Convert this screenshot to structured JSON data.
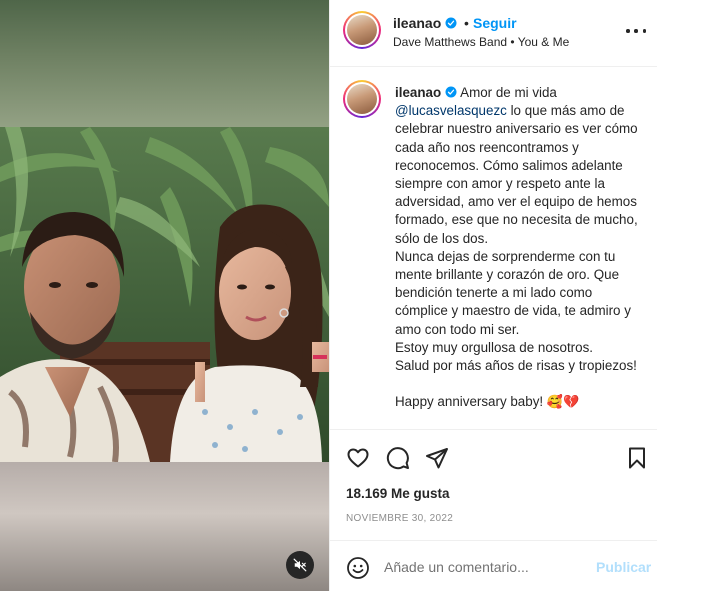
{
  "post": {
    "username": "ileanao",
    "follow_label": "Seguir",
    "separator": "•",
    "song": "Dave Matthews Band • You & Me",
    "caption_user": "ileanao",
    "caption_intro": "Amor de mi vida",
    "mention": "@lucasvelasquezc",
    "caption_body": " lo que más amo de celebrar nuestro aniversario es ver cómo cada año nos reencontramos y reconocemos. Cómo salimos adelante siempre con amor y respeto ante la adversidad, amo ver el equipo de hemos formado, ese que no necesita de mucho, sólo de los dos.\nNunca dejas de sorprenderme con tu mente brillante y corazón de oro. Que bendición tenerte a mi lado como cómplice y maestro de vida, te admiro y amo con todo mi ser.\nEstoy muy orgullosa de nosotros.\nSalud por más años de risas y tropiezos!\n\nHappy anniversary baby! ",
    "caption_emojis": "🥰💔",
    "likes": "18.169 Me gusta",
    "date": "NOVIEMBRE 30, 2022"
  },
  "comment": {
    "placeholder": "Añade un comentario...",
    "publish_label": "Publicar"
  },
  "icons": {
    "verified": "verified-badge-icon",
    "more": "more-options-icon",
    "like": "heart-icon",
    "comment": "comment-icon",
    "share": "share-icon",
    "save": "bookmark-icon",
    "emoji": "emoji-icon",
    "mute": "audio-muted-icon"
  },
  "colors": {
    "accent": "#0095f6",
    "publish_disabled": "#b2dffc",
    "text": "#262626",
    "secondary": "#8e8e8e",
    "mention": "#00376b"
  }
}
